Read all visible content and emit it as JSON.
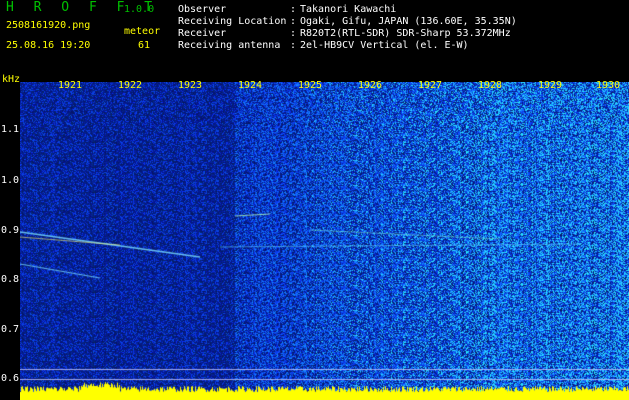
{
  "header": {
    "brand": "H R O F F T",
    "version": "1.0.0",
    "file_name": "2508161920.png",
    "meteor_label": "meteor",
    "date_time": "25.08.16 19:20",
    "meteor_count": "61"
  },
  "info": [
    {
      "label": "Observer",
      "value": "Takanori Kawachi"
    },
    {
      "label": "Receiving Location",
      "value": "Ogaki, Gifu, JAPAN (136.60E, 35.35N)"
    },
    {
      "label": "Receiver",
      "value": "R820T2(RTL-SDR) SDR-Sharp 53.372MHz"
    },
    {
      "label": "Receiving antenna",
      "value": "2el-HB9CV Vertical (el. E-W)"
    }
  ],
  "colon": ":",
  "axis": {
    "unit": "kHz",
    "time_ticks": [
      "1921",
      "1922",
      "1923",
      "1924",
      "1925",
      "1926",
      "1927",
      "1928",
      "1929",
      "1930"
    ],
    "freq_ticks": [
      "1.1",
      "1.0",
      "0.9",
      "0.8",
      "0.7",
      "0.6"
    ]
  },
  "colors": {
    "header_yellow": "#ffff00",
    "brand_green": "#00c000",
    "noise_dark": "#0a1a5a",
    "noise_bright": "#2a5aff",
    "signal_band": "#ffff00"
  }
}
